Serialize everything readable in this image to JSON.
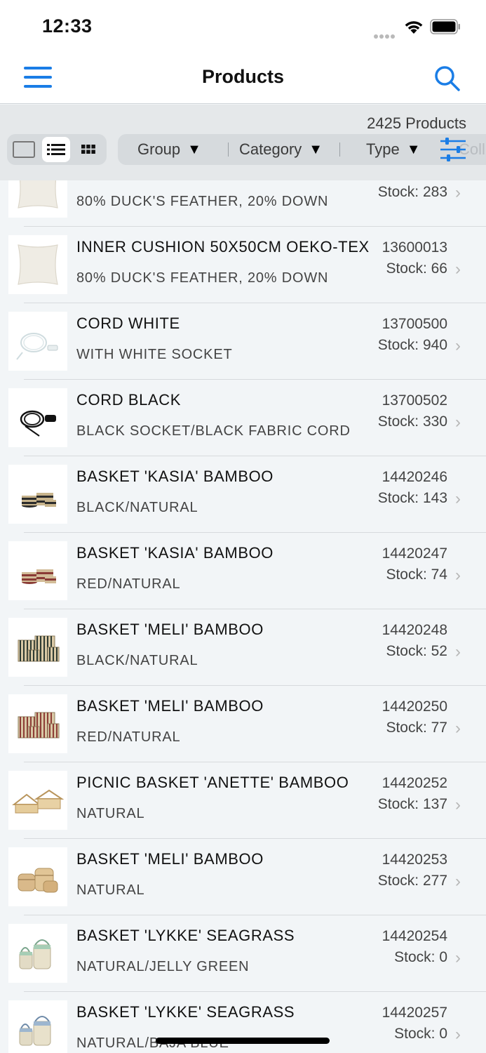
{
  "status_bar": {
    "time": "12:33"
  },
  "nav": {
    "title": "Products"
  },
  "toolbar": {
    "count_label": "2425 Products",
    "filters": {
      "group": "Group",
      "category": "Category",
      "type": "Type",
      "collection": "Coll"
    }
  },
  "products": [
    {
      "name": "",
      "description": "80% DUCK'S FEATHER, 20% DOWN",
      "code": "",
      "stock": "Stock: 283",
      "image": "cushion"
    },
    {
      "name": "INNER CUSHION 50X50CM OEKO-TEX",
      "description": "80% DUCK'S FEATHER, 20% DOWN",
      "code": "13600013",
      "stock": "Stock: 66",
      "image": "cushion"
    },
    {
      "name": "CORD WHITE",
      "description": "WITH WHITE SOCKET",
      "code": "13700500",
      "stock": "Stock: 940",
      "image": "cord-white"
    },
    {
      "name": "CORD BLACK",
      "description": "BLACK SOCKET/BLACK FABRIC CORD",
      "code": "13700502",
      "stock": "Stock: 330",
      "image": "cord-black"
    },
    {
      "name": "BASKET 'KASIA' BAMBOO",
      "description": "BLACK/NATURAL",
      "code": "14420246",
      "stock": "Stock: 143",
      "image": "basket-black"
    },
    {
      "name": "BASKET 'KASIA' BAMBOO",
      "description": "RED/NATURAL",
      "code": "14420247",
      "stock": "Stock: 74",
      "image": "basket-red"
    },
    {
      "name": "BASKET 'MELI' BAMBOO",
      "description": "BLACK/NATURAL",
      "code": "14420248",
      "stock": "Stock: 52",
      "image": "meli-black"
    },
    {
      "name": "BASKET 'MELI' BAMBOO",
      "description": "RED/NATURAL",
      "code": "14420250",
      "stock": "Stock: 77",
      "image": "meli-red"
    },
    {
      "name": "PICNIC BASKET 'ANETTE' BAMBOO",
      "description": "NATURAL",
      "code": "14420252",
      "stock": "Stock: 137",
      "image": "picnic"
    },
    {
      "name": "BASKET 'MELI' BAMBOO",
      "description": "NATURAL",
      "code": "14420253",
      "stock": "Stock: 277",
      "image": "meli-natural"
    },
    {
      "name": "BASKET 'LYKKE' SEAGRASS",
      "description": "NATURAL/JELLY GREEN",
      "code": "14420254",
      "stock": "Stock: 0",
      "image": "lykke-green"
    },
    {
      "name": "BASKET 'LYKKE' SEAGRASS",
      "description": "NATURAL/BAJA BLUE",
      "code": "14420257",
      "stock": "Stock: 0",
      "image": "lykke-blue"
    }
  ],
  "colors": {
    "accent": "#1a7de6",
    "background": "#f2f5f7",
    "toolbar": "#e5e8ea"
  }
}
